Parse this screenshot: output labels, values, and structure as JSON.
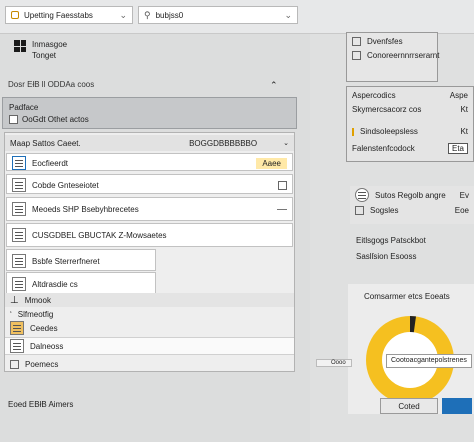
{
  "topbar": {
    "field_left": "Upetting Faesstabs",
    "field_right": "bubjss0"
  },
  "left": {
    "os_title": "Inmasgoe",
    "os_sub": "Tonget",
    "tagline": "Dosr EłB ll ODDAa coos",
    "header": {
      "title": "Padface",
      "checkbox_label": "OoGdt Othet actos"
    },
    "tree": {
      "header_left": "Maap Sattos Caeet.",
      "header_mid": "BOGGDBBBBBBO",
      "items": [
        {
          "label": "Eocfieerdt",
          "trail": "Aaee"
        },
        {
          "label": "Cobde Gnteseiotet",
          "trail": ""
        },
        {
          "label": "Meoeds SHP Bsebyhbrecetes",
          "trail": ""
        },
        {
          "label": "CUSGDBEL GBUCTAK Z‑Mowsaetes",
          "trail": ""
        },
        {
          "label": "Bsbfe Sterrerfneret",
          "trail": ""
        },
        {
          "label": "Altdrasdie cs",
          "trail": ""
        },
        {
          "label": "Mmook",
          "trail": ""
        },
        {
          "label": "Slfmeotfig",
          "trail": ""
        },
        {
          "label": "Ceedes",
          "trail": ""
        },
        {
          "label": "Dalneoss",
          "trail": ""
        },
        {
          "label": "Poemecs",
          "trail": ""
        }
      ]
    },
    "footer": "Eoed EBłB Aimers"
  },
  "right": {
    "top_items": [
      "Dvenfsfes",
      "Conoreernnrrserarnt"
    ],
    "section1": {
      "items": [
        "Aspercodics",
        "Skymercsacorz cos",
        "Sindsoleepsless",
        "Falenstenfcodock"
      ],
      "badges": [
        "Aspe",
        "Kt",
        "Kt",
        "Eta"
      ]
    },
    "section2": {
      "items": [
        "Sutos Regolb angre",
        "Sogsles"
      ],
      "badges": [
        "Ev",
        "Eoe"
      ]
    },
    "status": [
      "Eitlsgogs Patsckbot",
      "Saslſsion Esooss"
    ],
    "chart": {
      "title": "Comsarmer etcs Eoeats",
      "tooltip": "Cootoacgantepolstrenes",
      "tooltip_side": "Oooo"
    },
    "buttons": {
      "cancel": "Coted",
      "ok": ""
    }
  },
  "colors": {
    "accent": "#1e6fb8",
    "pie": "#f5c020",
    "highlight": "#ffe9a8"
  }
}
